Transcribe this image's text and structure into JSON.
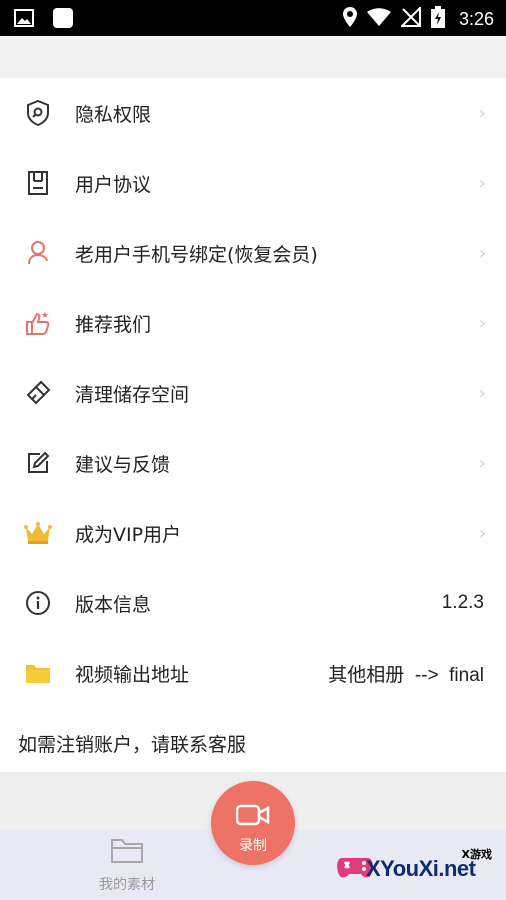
{
  "status_bar": {
    "time": "3:26"
  },
  "menu": [
    {
      "label": "隐私权限",
      "icon": "shield-search-icon",
      "arrow": "›"
    },
    {
      "label": "用户协议",
      "icon": "document-icon",
      "arrow": "›"
    },
    {
      "label": "老用户手机号绑定(恢复会员)",
      "icon": "user-icon",
      "arrow": "›"
    },
    {
      "label": "推荐我们",
      "icon": "thumbs-up-icon",
      "arrow": "›"
    },
    {
      "label": "清理储存空间",
      "icon": "broom-icon",
      "arrow": "›"
    },
    {
      "label": "建议与反馈",
      "icon": "edit-icon",
      "arrow": "›"
    },
    {
      "label": "成为VIP用户",
      "icon": "crown-icon",
      "arrow": "›"
    },
    {
      "label": "版本信息",
      "icon": "info-icon",
      "value": "1.2.3"
    },
    {
      "label": "视频输出地址",
      "icon": "folder-icon",
      "value": "其他相册  -->  final"
    }
  ],
  "note": "如需注销账户，请联系客服",
  "bottom_nav": {
    "left_tab": "我的素材",
    "record_label": "录制"
  },
  "watermark": {
    "brand": "XYouXi.net",
    "tag": "X游戏"
  },
  "colors": {
    "accent": "#ee7266",
    "crown": "#f0b93a",
    "folder": "#f2c02b",
    "icon_pink": "#e8736a"
  }
}
